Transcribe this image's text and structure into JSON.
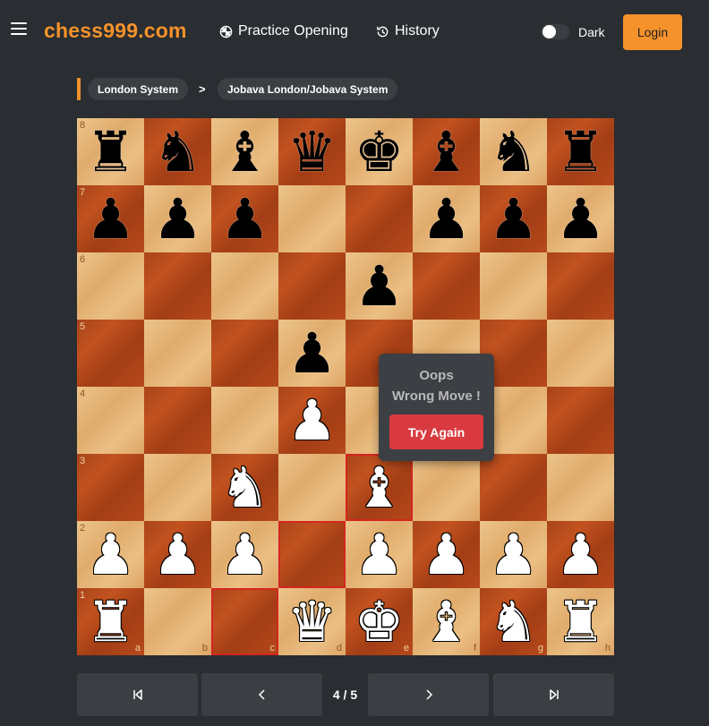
{
  "header": {
    "brand": "chess999.com",
    "nav": {
      "practice_label": "Practice Opening",
      "history_label": "History"
    },
    "theme_toggle": {
      "label": "Dark",
      "on": false
    },
    "login_label": "Login"
  },
  "breadcrumb": {
    "items": [
      "London System",
      "Jobava London/Jobava System"
    ],
    "separator": ">"
  },
  "board": {
    "ranks": [
      "8",
      "7",
      "6",
      "5",
      "4",
      "3",
      "2",
      "1"
    ],
    "files": [
      "a",
      "b",
      "c",
      "d",
      "e",
      "f",
      "g",
      "h"
    ],
    "position": [
      [
        "bR",
        "bN",
        "bB",
        "bQ",
        "bK",
        "bB",
        "bN",
        "bR"
      ],
      [
        "bP",
        "bP",
        "bP",
        "",
        "",
        "bP",
        "bP",
        "bP"
      ],
      [
        "",
        "",
        "",
        "",
        "bP",
        "",
        "",
        ""
      ],
      [
        "",
        "",
        "",
        "bP",
        "",
        "",
        "",
        ""
      ],
      [
        "",
        "",
        "",
        "wP",
        "",
        "",
        "",
        ""
      ],
      [
        "",
        "",
        "wN",
        "",
        "wB",
        "",
        "",
        ""
      ],
      [
        "wP",
        "wP",
        "wP",
        "",
        "wP",
        "wP",
        "wP",
        "wP"
      ],
      [
        "wR",
        "",
        "",
        "wQ",
        "wK",
        "wB",
        "wN",
        "wR"
      ]
    ],
    "highlighted_squares": [
      "e3",
      "d2",
      "c1"
    ],
    "colors": {
      "highlight": "#d3261f"
    }
  },
  "popup": {
    "line1": "Oops",
    "line2": "Wrong Move !",
    "button_label": "Try Again"
  },
  "controls": {
    "first_icon": "skip-back-icon",
    "prev_icon": "chevron-left-icon",
    "counter": "4 / 5",
    "next_icon": "chevron-right-icon",
    "last_icon": "skip-forward-icon"
  },
  "colors": {
    "accent": "#f5922b",
    "background": "#2a2d31",
    "danger": "#d83a3f"
  }
}
